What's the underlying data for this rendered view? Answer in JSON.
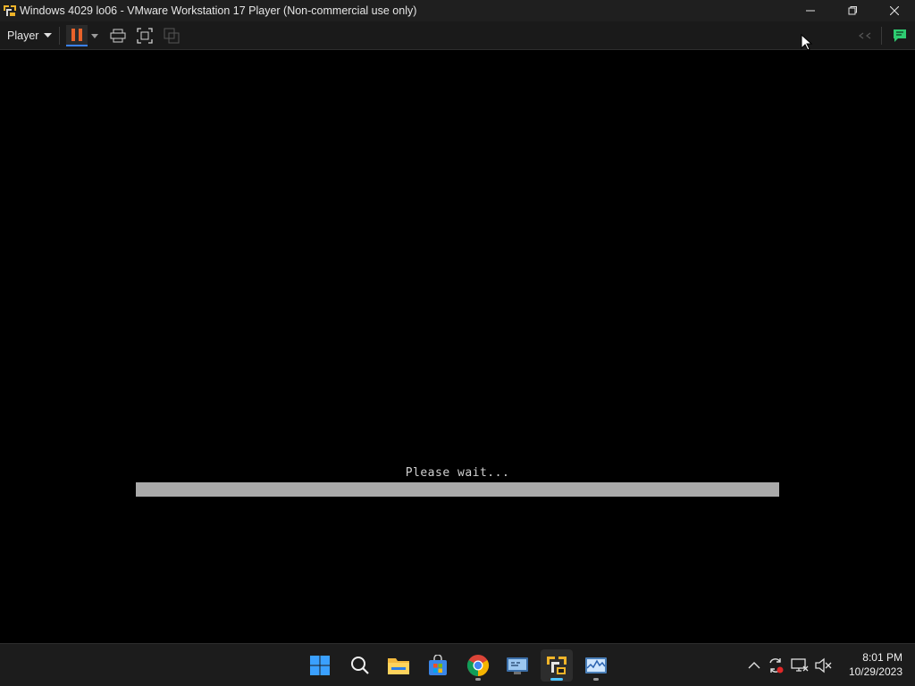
{
  "window": {
    "title": "Windows 4029 lo06 - VMware Workstation 17 Player (Non-commercial use only)",
    "icon": "vmware-logo-icon",
    "controls": [
      "minimize-icon",
      "restore-icon",
      "close-icon"
    ]
  },
  "toolbar": {
    "player_menu_label": "Player",
    "buttons": [
      "pause-icon",
      "dropdown-arrow-icon",
      "send-ctrl-alt-del-icon",
      "full-screen-icon",
      "unity-icon",
      "library-collapse-icon",
      "message-log-icon"
    ],
    "pause_color": "#e8622a",
    "message_log_color": "#2ecc71"
  },
  "vm_screen": {
    "status_text": "Please wait...",
    "progress_fraction": 1.0
  },
  "taskbar": {
    "apps": [
      "start-icon",
      "search-icon",
      "file-explorer-icon",
      "microsoft-store-icon",
      "chrome-icon",
      "remote-desktop-icon",
      "vmware-player-icon",
      "resource-monitor-icon"
    ],
    "active_app": "vmware-player-icon",
    "tray": [
      "show-hidden-icons-chevron",
      "sync-icon",
      "network-icon",
      "volume-muted-icon"
    ],
    "clock": {
      "time": "8:01 PM",
      "date": "10/29/2023"
    }
  }
}
